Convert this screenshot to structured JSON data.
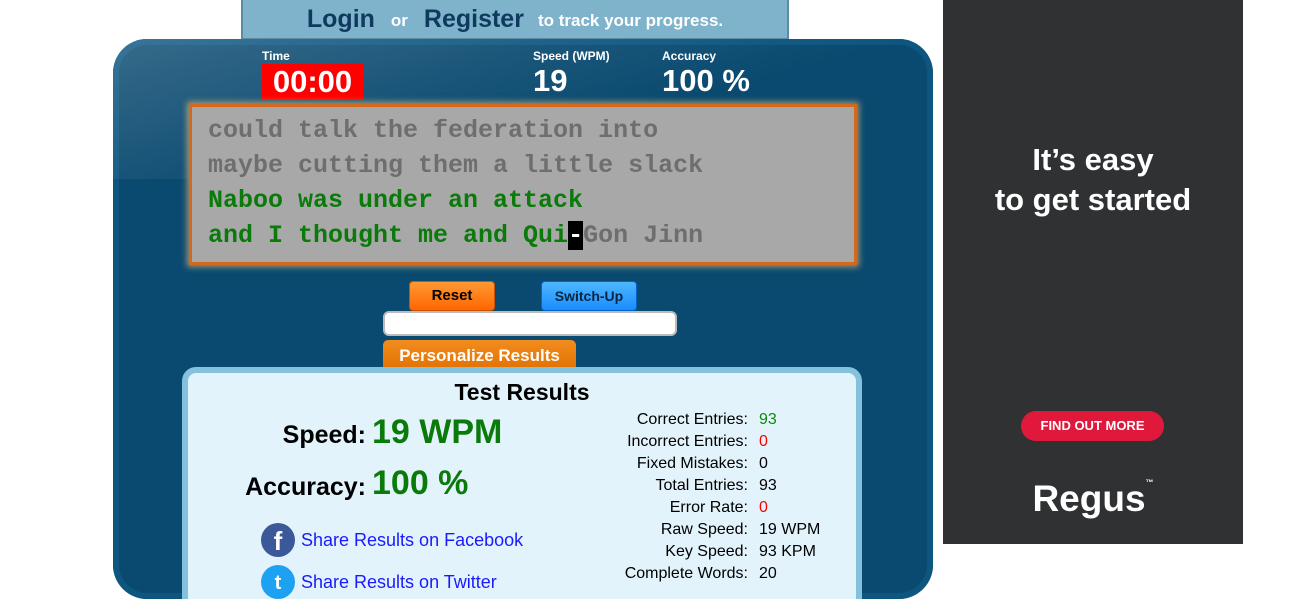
{
  "auth": {
    "login": "Login",
    "or": "or",
    "register": "Register",
    "note": "to track your progress."
  },
  "stats": {
    "time_label": "Time",
    "time_value": "00:00",
    "speed_label": "Speed (WPM)",
    "speed_value": "19",
    "accuracy_label": "Accuracy",
    "accuracy_value": "100 %"
  },
  "typing": {
    "lines": [
      {
        "typed": "",
        "remaining": "could talk the federation into"
      },
      {
        "typed": "",
        "remaining": "maybe cutting them a little slack"
      },
      {
        "typed": "Naboo was under an attack",
        "remaining": ""
      },
      {
        "typed": "and I thought me and Qui",
        "cursor": "-",
        "remaining": "Gon Jinn"
      }
    ]
  },
  "controls": {
    "reset": "Reset",
    "switch_up": "Switch-Up",
    "personalize": "Personalize Results",
    "input_value": ""
  },
  "results": {
    "title": "Test Results",
    "speed_label": "Speed:",
    "speed_value": "19 WPM",
    "accuracy_label": "Accuracy:",
    "accuracy_value": "100 %",
    "share_facebook": "Share Results on Facebook",
    "share_twitter": "Share Results on Twitter",
    "details": [
      {
        "label": "Correct Entries:",
        "value": "93",
        "color": "green"
      },
      {
        "label": "Incorrect Entries:",
        "value": "0",
        "color": "red"
      },
      {
        "label": "Fixed Mistakes:",
        "value": "0",
        "color": "black"
      },
      {
        "label": "Total Entries:",
        "value": "93",
        "color": "black"
      },
      {
        "label": "Error Rate:",
        "value": "0",
        "color": "red"
      },
      {
        "label": "Raw Speed:",
        "value": "19 WPM",
        "color": "black"
      },
      {
        "label": "Key Speed:",
        "value": "93 KPM",
        "color": "black"
      },
      {
        "label": "Complete Words:",
        "value": "20",
        "color": "black"
      }
    ]
  },
  "ad": {
    "headline_1": "It’s easy",
    "headline_2": "to get started",
    "button": "FIND OUT MORE",
    "logo": "Regus",
    "logo_tm": "™"
  }
}
